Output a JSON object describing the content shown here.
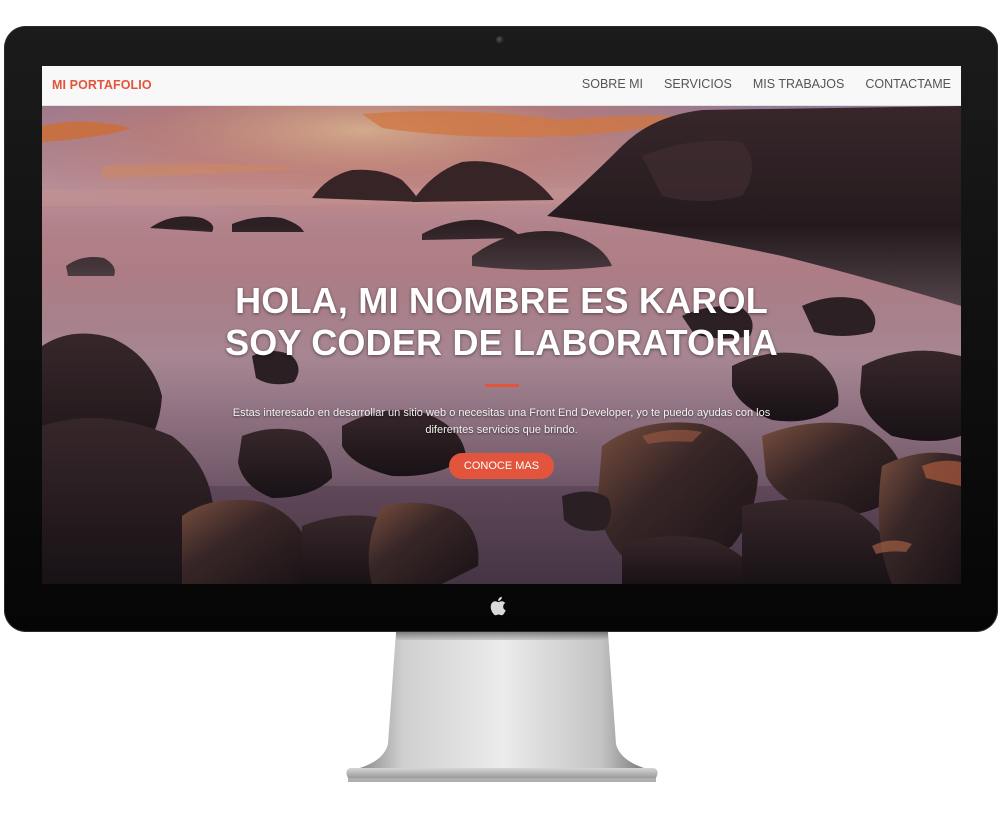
{
  "navbar": {
    "brand": "MI PORTAFOLIO",
    "links": [
      "SOBRE MI",
      "SERVICIOS",
      "MIS TRABAJOS",
      "CONTACTAME"
    ]
  },
  "hero": {
    "heading_line1": "HOLA, MI NOMBRE ES KAROL",
    "heading_line2": "SOY CODER DE LABORATORIA",
    "text": "Estas interesado en desarrollar un sitio web o necesitas una Front End Developer, yo te puedo ayudas con los diferentes servicios que brindo.",
    "cta_label": "CONOCE MAS"
  },
  "colors": {
    "accent": "#e2553c",
    "navbar_bg": "#f8f8f8",
    "nav_text": "#555555",
    "bezel": "#0d0d0d"
  },
  "icons": {
    "camera": "camera-icon",
    "logo": "apple-logo-icon"
  }
}
